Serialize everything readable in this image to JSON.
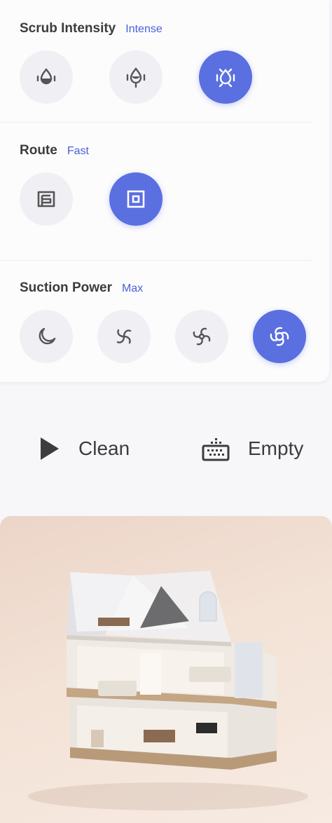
{
  "scrub": {
    "label": "Scrub Intensity",
    "value": "Intense",
    "options": [
      {
        "icon": "water-drop-low-icon",
        "active": false
      },
      {
        "icon": "water-drop-medium-icon",
        "active": false
      },
      {
        "icon": "water-drop-intense-icon",
        "active": true
      }
    ]
  },
  "route": {
    "label": "Route",
    "value": "Fast",
    "options": [
      {
        "icon": "route-deep-icon",
        "active": false
      },
      {
        "icon": "route-fast-icon",
        "active": true
      }
    ]
  },
  "suction": {
    "label": "Suction Power",
    "value": "Max",
    "options": [
      {
        "icon": "moon-quiet-icon",
        "active": false
      },
      {
        "icon": "fan-standard-icon",
        "active": false
      },
      {
        "icon": "fan-turbo-icon",
        "active": false
      },
      {
        "icon": "fan-max-icon",
        "active": true
      }
    ]
  },
  "actions": {
    "clean": "Clean",
    "empty": "Empty"
  },
  "colors": {
    "accent": "#5a6fe0",
    "accent_text": "#4a5fd8",
    "inactive": "#f0eff4"
  }
}
